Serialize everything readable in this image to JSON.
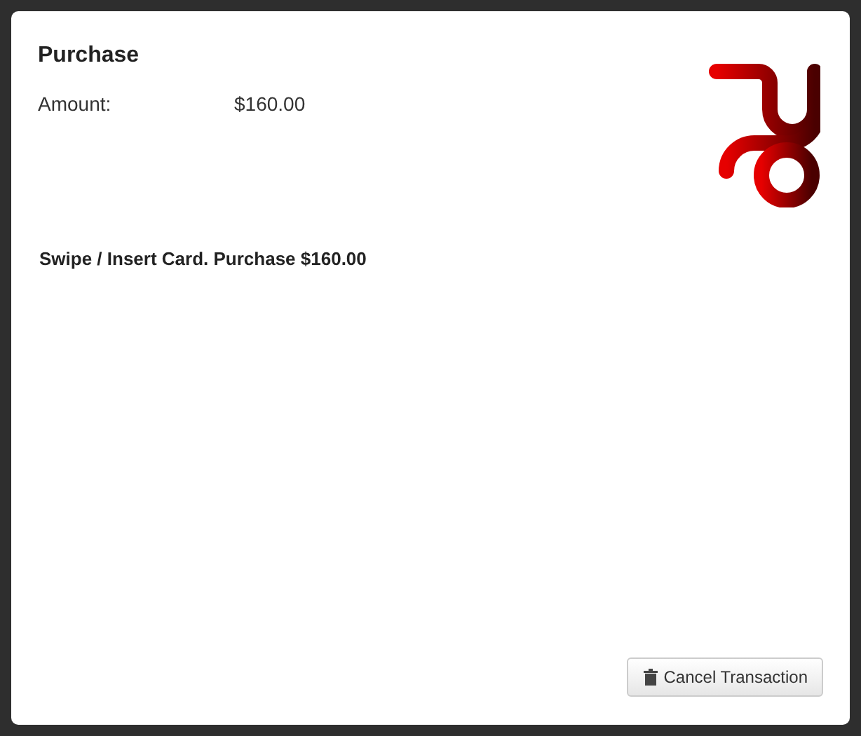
{
  "dialog": {
    "title": "Purchase",
    "fields": [
      {
        "label": "Amount:",
        "value": "$160.00"
      }
    ],
    "message": "Swipe / Insert Card. Purchase $160.00",
    "buttons": [
      {
        "label": "Cancel Transaction",
        "kind": "cancel"
      }
    ]
  }
}
